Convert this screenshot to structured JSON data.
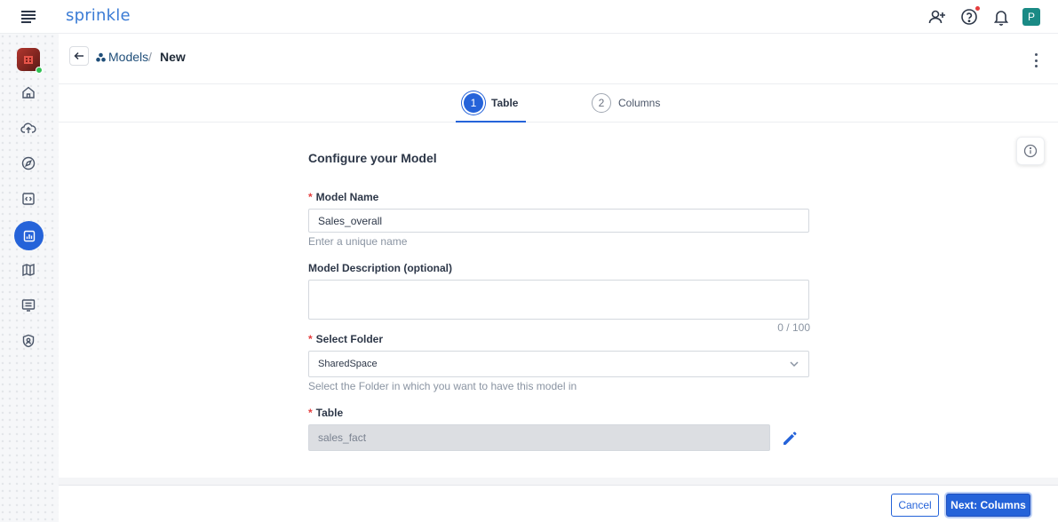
{
  "app": {
    "logo_text": "sprinkle",
    "avatar_initial": "P"
  },
  "colors": {
    "brand": "#2563d9",
    "logo": "#3a7bd5",
    "avatar": "#1a8a85",
    "required": "#e53e3e"
  },
  "topbar": {
    "icons": [
      "add-user-icon",
      "help-icon",
      "bell-icon"
    ]
  },
  "sidebar": {
    "items": [
      "home-icon",
      "cloud-upload-icon",
      "compass-icon",
      "code-icon",
      "chart-icon",
      "map-icon",
      "list-icon",
      "shield-icon"
    ],
    "active": "chart-icon"
  },
  "breadcrumb": {
    "models": "Models",
    "separator": "/",
    "current": "New"
  },
  "steps": [
    {
      "number": "1",
      "label": "Table",
      "active": true
    },
    {
      "number": "2",
      "label": "Columns",
      "active": false
    }
  ],
  "form": {
    "title": "Configure your Model",
    "model_name": {
      "required_mark": "*",
      "label": "Model Name",
      "value": "Sales_overall",
      "hint": "Enter a unique name"
    },
    "description": {
      "label": "Model Description (optional)",
      "value": "",
      "counter": "0 / 100"
    },
    "folder": {
      "required_mark": "*",
      "label": "Select Folder",
      "value": "SharedSpace",
      "hint": "Select the Folder in which you want to have this model in"
    },
    "table": {
      "required_mark": "*",
      "label": "Table",
      "value": "sales_fact"
    }
  },
  "footer": {
    "cancel_label": "Cancel",
    "next_label": "Next: Columns"
  }
}
